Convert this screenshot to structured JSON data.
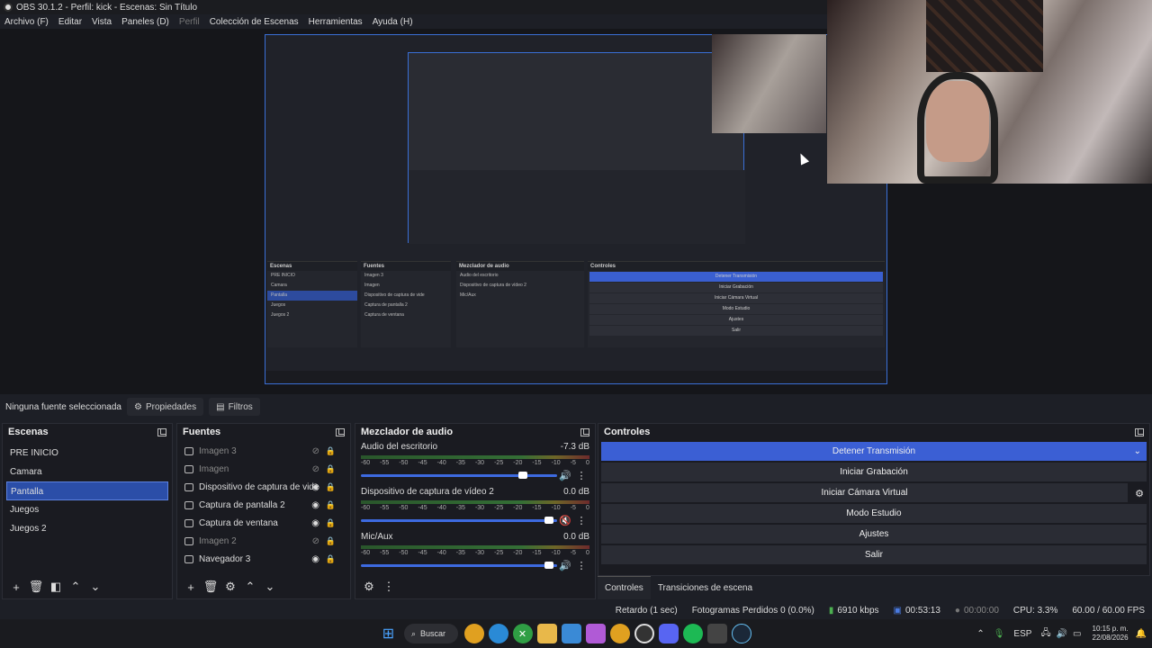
{
  "window_title": "OBS 30.1.2 - Perfil: kick - Escenas: Sin Título",
  "menu": [
    "Archivo (F)",
    "Editar",
    "Vista",
    "Paneles (D)",
    "Perfil",
    "Colección de Escenas",
    "Herramientas",
    "Ayuda (H)"
  ],
  "source_bar": {
    "no_source": "Ninguna fuente seleccionada",
    "properties": "Propiedades",
    "filters": "Filtros"
  },
  "scenes": {
    "title": "Escenas",
    "items": [
      "PRE INICIO",
      "Camara",
      "Pantalla",
      "Juegos",
      "Juegos 2"
    ],
    "selected": "Pantalla"
  },
  "sources": {
    "title": "Fuentes",
    "items": [
      {
        "label": "Imagen 3",
        "dim": true
      },
      {
        "label": "Imagen",
        "dim": true
      },
      {
        "label": "Dispositivo de captura de vide",
        "dim": false
      },
      {
        "label": "Captura de pantalla 2",
        "dim": false
      },
      {
        "label": "Captura de ventana",
        "dim": false
      },
      {
        "label": "Imagen 2",
        "dim": true
      },
      {
        "label": "Navegador 3",
        "dim": false
      }
    ]
  },
  "mixer": {
    "title": "Mezclador de audio",
    "tracks": [
      {
        "name": "Audio del escritorio",
        "db": "-7.3 dB",
        "level": 0.85
      },
      {
        "name": "Dispositivo de captura de vídeo 2",
        "db": "0.0 dB",
        "level": 0.98
      },
      {
        "name": "Mic/Aux",
        "db": "0.0 dB",
        "level": 0.98
      }
    ],
    "ticks": [
      "-60",
      "-55",
      "-50",
      "-45",
      "-40",
      "-35",
      "-30",
      "-25",
      "-20",
      "-15",
      "-10",
      "-5",
      "0"
    ]
  },
  "controls": {
    "title": "Controles",
    "buttons": [
      "Detener Transmisión",
      "Iniciar Grabación",
      "Iniciar Cámara Virtual",
      "Modo Estudio",
      "Ajustes",
      "Salir"
    ],
    "tabs": [
      "Controles",
      "Transiciones de escena"
    ]
  },
  "status": {
    "delay": "Retardo (1 sec)",
    "dropped": "Fotogramas Perdidos 0 (0.0%)",
    "kbps": "6910 kbps",
    "live_time": "00:53:13",
    "rec_time": "00:00:00",
    "cpu": "CPU: 3.3%",
    "fps": "60.00 / 60.00 FPS"
  },
  "taskbar": {
    "search": "Buscar",
    "lang": "ESP",
    "time": "10:15 p. m.",
    "date": "22/08/2026"
  },
  "colors": {
    "accent": "#3b5fd4",
    "selection": "#2b4ea8"
  }
}
